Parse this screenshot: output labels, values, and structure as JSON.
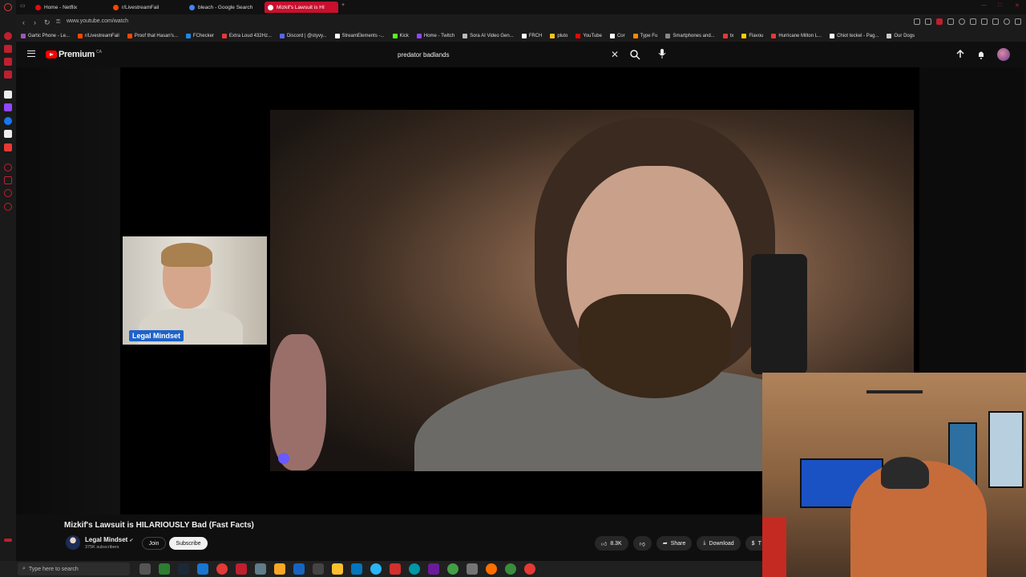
{
  "browser": {
    "tabs": [
      {
        "label": "Home - Netflix",
        "color": "#e50914"
      },
      {
        "label": "r/LivestreamFail",
        "color": "#ff4500"
      },
      {
        "label": "bleach - Google Search",
        "color": "#4285f4"
      },
      {
        "label": "Mizkif's Lawsuit is HI",
        "color": "#ffffff",
        "active": true
      }
    ],
    "new_tab_icon": "plus-icon",
    "url": "www.youtube.com/watch",
    "bookmarks": [
      {
        "label": "Gartic Phone - Le...",
        "color": "#9b59b6"
      },
      {
        "label": "r/LivestreamFail",
        "color": "#ff4500"
      },
      {
        "label": "Proof that Hasan's...",
        "color": "#ff4500"
      },
      {
        "label": "FChecker",
        "color": "#1e88e5"
      },
      {
        "label": "Extra Loud 432Hz...",
        "color": "#e53935"
      },
      {
        "label": "Discord | @styvy...",
        "color": "#5865f2"
      },
      {
        "label": "StreamElements -...",
        "color": "#ffffff"
      },
      {
        "label": "Kick",
        "color": "#53fc18"
      },
      {
        "label": "Home - Twitch",
        "color": "#9146ff"
      },
      {
        "label": "Sora AI Video Gen...",
        "color": "#bbbbbb"
      },
      {
        "label": "FRCH",
        "color": "#ffffff"
      },
      {
        "label": "pluto",
        "color": "#f5c518"
      },
      {
        "label": "YouTube",
        "color": "#ff0000"
      },
      {
        "label": "Cor",
        "color": "#ffffff"
      },
      {
        "label": "Type Fu",
        "color": "#ff8800"
      },
      {
        "label": "Smartphones and...",
        "color": "#888888"
      },
      {
        "label": "tx",
        "color": "#e53935"
      },
      {
        "label": "Flavou",
        "color": "#ffcc00"
      },
      {
        "label": "Hurricane Milton L...",
        "color": "#e53935"
      },
      {
        "label": "Chiot teckel - Pag...",
        "color": "#ffffff"
      },
      {
        "label": "Our Dogs",
        "color": "#cccccc"
      }
    ]
  },
  "youtube": {
    "logo_text": "Premium",
    "logo_country": "CA",
    "search_query": "predator badlands",
    "video": {
      "title": "Mizkif's Lawsuit is HILARIOUSLY Bad (Fast Facts)",
      "overlay_name_tag": "Legal Mindset"
    },
    "channel": {
      "name": "Legal Mindset",
      "subscribers": "375K subscribers",
      "join_label": "Join",
      "subscribe_label": "Subscribe"
    },
    "actions": {
      "likes": "8.3K",
      "share_label": "Share",
      "download_label": "Download",
      "more_label": "T"
    }
  },
  "taskbar": {
    "search_placeholder": "Type here to search"
  },
  "colors": {
    "accent_red": "#ff0000",
    "active_tab": "#c8102e",
    "background": "#0f0f0f"
  }
}
